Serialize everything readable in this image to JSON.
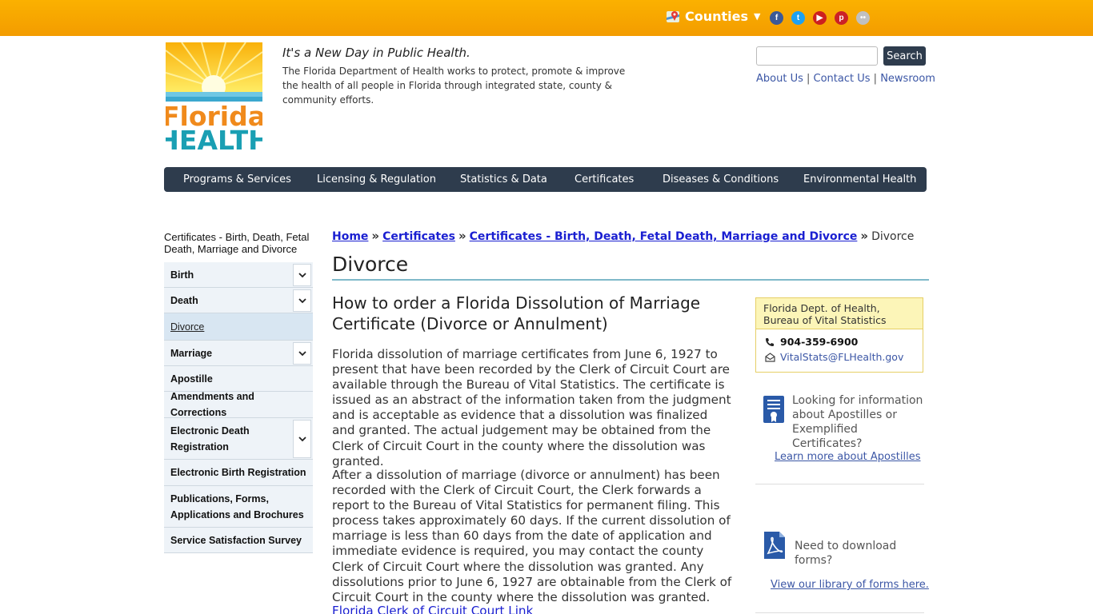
{
  "topbar": {
    "counties_label": "Counties",
    "social": [
      {
        "name": "facebook",
        "glyph": "f",
        "color": "#3b5998"
      },
      {
        "name": "twitter",
        "glyph": "t",
        "color": "#1da1f2"
      },
      {
        "name": "youtube",
        "glyph": "▶",
        "color": "#cd201f"
      },
      {
        "name": "pinterest",
        "glyph": "p",
        "color": "#cb2027"
      },
      {
        "name": "flickr",
        "glyph": "••",
        "color": "#c0c0c0"
      }
    ]
  },
  "header": {
    "logo_word1": "Florida",
    "logo_word2": "HEALTH",
    "tagline": "It's a New Day in Public Health.",
    "mission": "The Florida Department of Health works to protect, promote & improve the health of all people in Florida through integrated state, county & community efforts.",
    "search_button": "Search",
    "about": "About Us",
    "contact": "Contact Us",
    "newsroom": "Newsroom",
    "divider": "|"
  },
  "nav": [
    "Programs & Services",
    "Licensing & Regulation",
    "Statistics & Data",
    "Certificates",
    "Diseases & Conditions",
    "Environmental Health"
  ],
  "sidebar": {
    "title": "Certificates - Birth, Death, Fetal Death, Marriage and Divorce",
    "items": [
      {
        "label": "Birth",
        "expandable": true,
        "h": 32
      },
      {
        "label": "Death",
        "expandable": true,
        "h": 32
      },
      {
        "label": "Divorce",
        "expandable": false,
        "h": 34,
        "active": true
      },
      {
        "label": "Marriage",
        "expandable": true,
        "h": 32
      },
      {
        "label": "Apostille",
        "expandable": false,
        "h": 32
      },
      {
        "label": "Amendments and Corrections",
        "expandable": false,
        "h": 33
      },
      {
        "label": "Electronic Death Registration",
        "expandable": true,
        "h": 52
      },
      {
        "label": "Electronic Birth Registration",
        "expandable": false,
        "h": 33
      },
      {
        "label": "Publications, Forms, Applications and Brochures",
        "expandable": false,
        "h": 52
      },
      {
        "label": "Service Satisfaction Survey",
        "expandable": false,
        "h": 32
      }
    ]
  },
  "breadcrumb": {
    "home": "Home",
    "certificates": "Certificates",
    "section": "Certificates - Birth, Death, Fetal Death, Marriage and Divorce",
    "current": "Divorce",
    "sep": "»"
  },
  "main": {
    "title": "Divorce",
    "subhead": "How to order a Florida Dissolution of Marriage Certificate (Divorce or Annulment)",
    "para1": "Florida dissolution of marriage certificates from June 6, 1927 to present that have been recorded by the Clerk of Circuit Court are available through the Bureau of Vital Statistics. The certificate is issued as an abstract of the information taken from the judgment and is acceptable as evidence that a dissolution was finalized and granted. The actual judgement may be obtained from the Clerk of Circuit Court in the county where the dissolution was granted.",
    "para2": "After a dissolution of marriage (divorce or annulment) has been recorded with the Clerk of Circuit Court, the Clerk forwards a report to the Bureau of Vital Statistics for permanent filing. This process takes approximately 60 days. If the current dissolution of marriage is less than 60 days from the date of application and immediate evidence is required, you may contact the county Clerk of Circuit Court where the dissolution was granted. Any dissolutions prior to June 6, 1927 are obtainable from the Clerk of Circuit Court in the county where the dissolution was granted.",
    "clerk_link": "Florida Clerk of Circuit Court Link"
  },
  "rightcol": {
    "contact_title": "Florida Dept. of Health, Bureau of Vital Statistics",
    "phone": "904-359-6900",
    "email": "VitalStats@FLHealth.gov",
    "apostille_text": "Looking for information about Apostilles or Exemplified Certificates?",
    "apostille_link": "Learn more about Apostilles",
    "forms_text": "Need to download forms?",
    "forms_link": "View our library of forms here."
  },
  "colors": {
    "topbar": "#f7a800",
    "nav": "#2e3c4d",
    "link": "#1a1fd1",
    "rule": "#7fb9c9"
  }
}
